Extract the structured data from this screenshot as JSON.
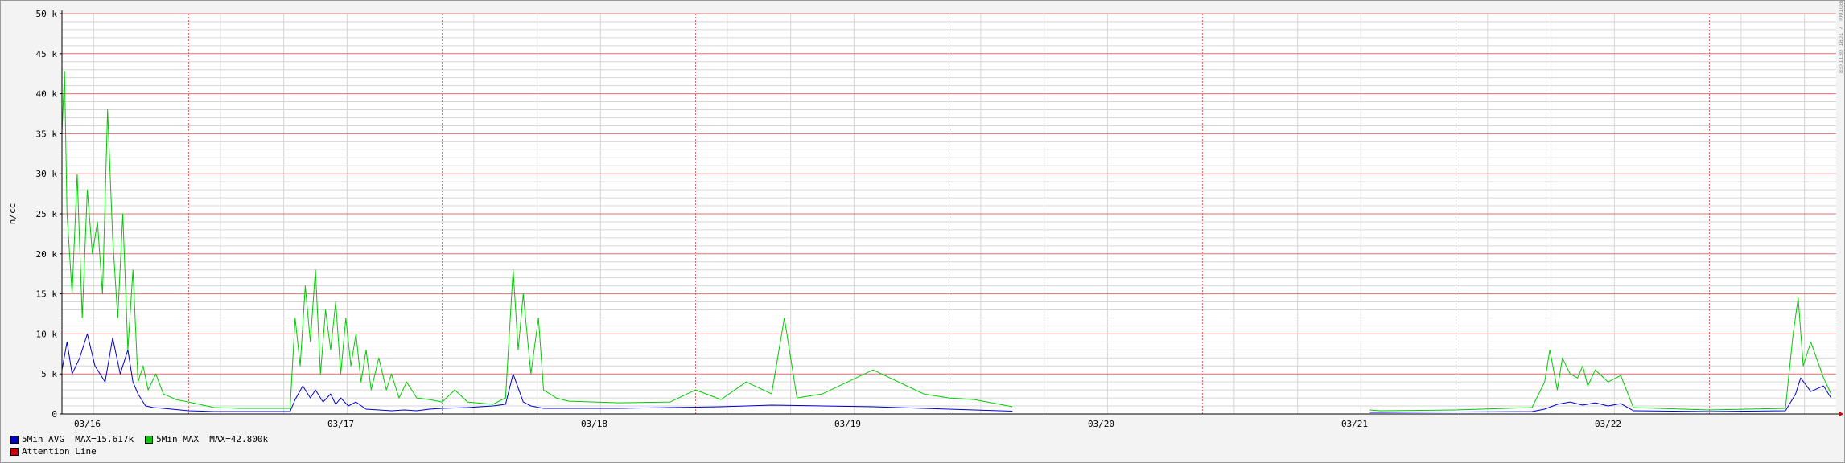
{
  "chart_data": {
    "type": "line",
    "ylabel": "n/cc",
    "watermark": "RRDTOOL / TOBI OETIKER",
    "ylim": [
      0,
      50000
    ],
    "y_tick_labels": [
      "0",
      "5 k",
      "10 k",
      "15 k",
      "20 k",
      "25 k",
      "30 k",
      "35 k",
      "40 k",
      "45 k",
      "50 k"
    ],
    "y_tick_values": [
      0,
      5000,
      10000,
      15000,
      20000,
      25000,
      30000,
      35000,
      40000,
      45000,
      50000
    ],
    "x_range_days": [
      "03/16",
      "03/23"
    ],
    "x_tick_labels": [
      "03/16",
      "03/17",
      "03/18",
      "03/19",
      "03/20",
      "03/21",
      "03/22"
    ],
    "grid": true,
    "legend_position": "bottom-left",
    "series": [
      {
        "name": "5Min AVG",
        "legend_text": "5Min AVG  MAX=15.617k",
        "color": "#0000cc",
        "x": [
          0.0,
          0.02,
          0.04,
          0.07,
          0.1,
          0.13,
          0.17,
          0.2,
          0.23,
          0.26,
          0.28,
          0.3,
          0.33,
          0.36,
          0.4,
          0.5,
          0.6,
          0.7,
          0.9,
          0.92,
          0.95,
          0.98,
          1.0,
          1.03,
          1.06,
          1.08,
          1.1,
          1.13,
          1.16,
          1.2,
          1.25,
          1.3,
          1.35,
          1.4,
          1.45,
          1.5,
          1.6,
          1.7,
          1.75,
          1.78,
          1.82,
          1.85,
          1.9,
          2.0,
          2.2,
          2.4,
          2.6,
          2.8,
          3.0,
          3.2,
          3.4,
          3.5,
          3.6,
          3.7,
          3.75,
          3.76,
          4.0,
          5.0,
          5.16,
          5.2,
          5.5,
          5.8,
          5.85,
          5.9,
          5.95,
          6.0,
          6.05,
          6.1,
          6.15,
          6.2,
          6.5,
          6.8,
          6.84,
          6.86,
          6.9,
          6.95,
          6.98
        ],
        "values": [
          5500,
          9000,
          5000,
          7000,
          10000,
          6000,
          4000,
          9500,
          5000,
          8000,
          4000,
          2500,
          1000,
          800,
          700,
          400,
          300,
          300,
          300,
          1800,
          3500,
          2000,
          3000,
          1500,
          2500,
          1200,
          2000,
          1000,
          1500,
          600,
          500,
          400,
          500,
          400,
          600,
          700,
          800,
          1000,
          1200,
          5000,
          1500,
          1000,
          700,
          700,
          700,
          800,
          900,
          1100,
          1000,
          900,
          700,
          600,
          500,
          400,
          350,
          null,
          null,
          null,
          200,
          200,
          250,
          300,
          600,
          1200,
          1500,
          1100,
          1400,
          1000,
          1300,
          400,
          300,
          400,
          2500,
          4500,
          2800,
          3500,
          2000
        ]
      },
      {
        "name": "5Min MAX",
        "legend_text": "5Min MAX  MAX=42.800k",
        "color": "#00cc00",
        "x": [
          0.0,
          0.01,
          0.02,
          0.04,
          0.06,
          0.08,
          0.1,
          0.12,
          0.14,
          0.16,
          0.18,
          0.2,
          0.22,
          0.24,
          0.26,
          0.28,
          0.3,
          0.32,
          0.34,
          0.37,
          0.4,
          0.45,
          0.5,
          0.6,
          0.7,
          0.9,
          0.92,
          0.94,
          0.96,
          0.98,
          1.0,
          1.02,
          1.04,
          1.06,
          1.08,
          1.1,
          1.12,
          1.14,
          1.16,
          1.18,
          1.2,
          1.22,
          1.25,
          1.28,
          1.3,
          1.33,
          1.36,
          1.4,
          1.45,
          1.5,
          1.55,
          1.6,
          1.7,
          1.75,
          1.78,
          1.8,
          1.82,
          1.85,
          1.88,
          1.9,
          1.95,
          2.0,
          2.2,
          2.4,
          2.5,
          2.6,
          2.7,
          2.8,
          2.85,
          2.9,
          3.0,
          3.2,
          3.4,
          3.5,
          3.6,
          3.7,
          3.75,
          3.76,
          4.0,
          5.0,
          5.16,
          5.2,
          5.5,
          5.8,
          5.85,
          5.87,
          5.9,
          5.92,
          5.95,
          5.98,
          6.0,
          6.02,
          6.05,
          6.1,
          6.15,
          6.2,
          6.5,
          6.8,
          6.83,
          6.85,
          6.87,
          6.9,
          6.95,
          6.98
        ],
        "values": [
          35000,
          42800,
          25000,
          15000,
          30000,
          12000,
          28000,
          20000,
          24000,
          15000,
          38000,
          22000,
          12000,
          25000,
          8000,
          18000,
          4000,
          6000,
          3000,
          5000,
          2500,
          1800,
          1500,
          800,
          700,
          700,
          12000,
          6000,
          16000,
          9000,
          18000,
          5000,
          13000,
          8000,
          14000,
          5000,
          12000,
          6000,
          10000,
          4000,
          8000,
          3000,
          7000,
          3000,
          5000,
          2000,
          4000,
          2000,
          1800,
          1500,
          3000,
          1500,
          1200,
          2000,
          18000,
          8000,
          15000,
          5000,
          12000,
          3000,
          2000,
          1600,
          1400,
          1500,
          3000,
          1800,
          4000,
          2500,
          12000,
          2000,
          2500,
          5500,
          2500,
          2000,
          1800,
          1200,
          900,
          null,
          null,
          null,
          500,
          400,
          500,
          800,
          4000,
          8000,
          3000,
          7000,
          5000,
          4500,
          6000,
          3500,
          5500,
          4000,
          4800,
          800,
          500,
          700,
          10000,
          14500,
          6000,
          9000,
          4500,
          2500
        ]
      }
    ],
    "extra_legend": {
      "name": "Attention Line",
      "color": "#cc0000"
    }
  }
}
